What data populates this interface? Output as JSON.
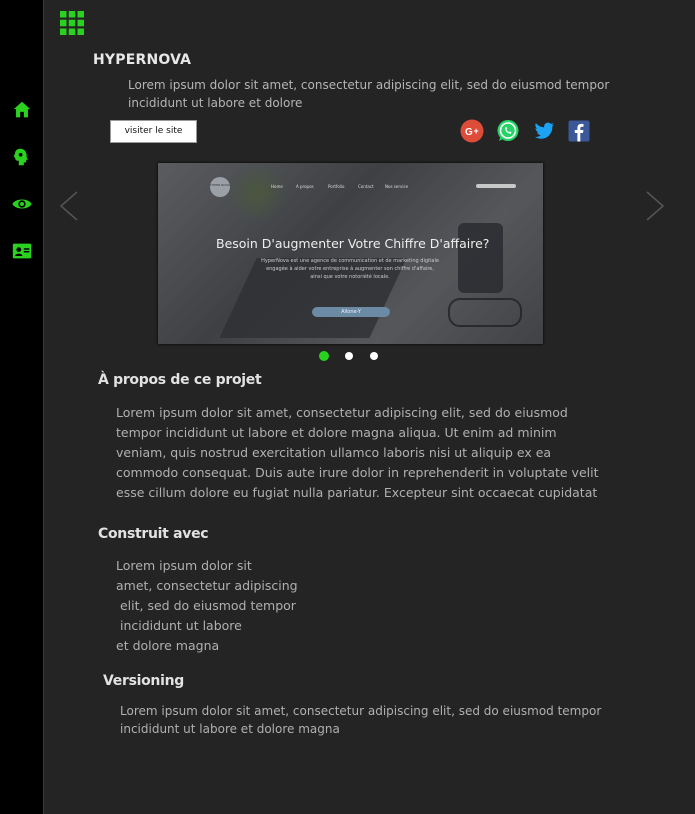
{
  "sidebar": {
    "items": [
      {
        "icon": "home-icon"
      },
      {
        "icon": "brain-icon"
      },
      {
        "icon": "eye-icon"
      },
      {
        "icon": "contact-card-icon"
      }
    ],
    "accent": "#2bd11f"
  },
  "header": {
    "menu_icon": "grid-menu-icon"
  },
  "project": {
    "title": "HYPERNOVA",
    "intro": "Lorem ipsum dolor sit amet, consectetur adipiscing elit, sed do eiusmod tempor incididunt ut labore et dolore",
    "visit_label": "visiter le site",
    "social": [
      "google-plus-icon",
      "whatsapp-icon",
      "twitter-icon",
      "facebook-icon"
    ]
  },
  "carousel": {
    "slide": {
      "logo": "HYPER NOVA",
      "nav": [
        "Home",
        "A propos",
        "Portfolio",
        "Contact",
        "Nos service"
      ],
      "heading": "Besoin D'augmenter Votre Chiffre D'affaire?",
      "sub": [
        "HyperNova est une agence de communication et de marketing digitale",
        "engagée à aider votre entreprise à augmenter son chiffre d'affaire,",
        "ainsi que votre notoriété locale."
      ],
      "button": "Allone-Y"
    },
    "slide_count": 3,
    "active_index": 0
  },
  "about": {
    "heading": "À propos de ce projet",
    "lines": [
      "Lorem ipsum dolor sit amet, consectetur adipiscing elit, sed do eiusmod",
      "tempor incididunt ut labore et dolore magna aliqua. Ut enim ad minim",
      "veniam, quis nostrud exercitation ullamco laboris nisi ut aliquip ex ea",
      "commodo consequat. Duis aute irure dolor in reprehenderit in voluptate velit",
      "esse cillum dolore eu fugiat nulla pariatur. Excepteur sint occaecat cupidatat"
    ]
  },
  "built_with": {
    "heading": "Construit avec",
    "lines": [
      "Lorem ipsum dolor sit",
      "amet, consectetur adipiscing",
      " elit, sed do eiusmod tempor",
      " incididunt ut labore",
      "et dolore magna"
    ]
  },
  "versioning": {
    "heading": "Versioning",
    "text": "Lorem ipsum dolor sit amet, consectetur adipiscing elit, sed do eiusmod tempor incididunt ut labore et dolore magna"
  }
}
